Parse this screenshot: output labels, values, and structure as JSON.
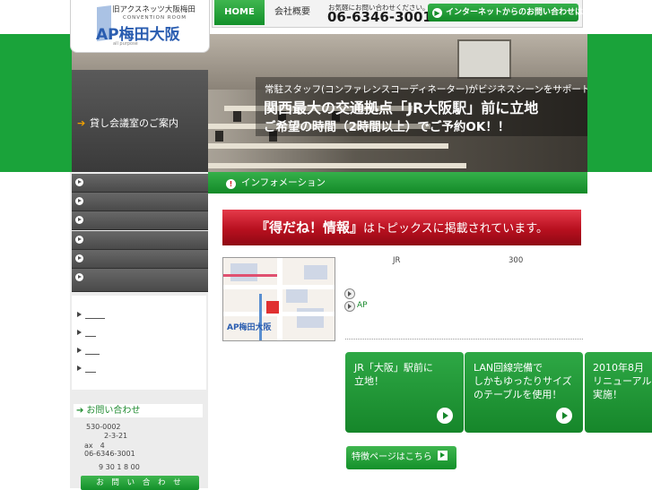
{
  "colors": {
    "brand_green": "#1aa33a",
    "accent_red": "#b8101f",
    "logo_blue": "#2a5db0"
  },
  "logo": {
    "top_text": "旧アクスネッツ大阪梅田",
    "subtitle": "CONVENTION ROOM",
    "main_text": "AP梅田大阪",
    "tagline": "all purpose"
  },
  "header": {
    "nav": [
      {
        "label": "HOME"
      },
      {
        "label": "会社概要"
      }
    ],
    "contact_note": "お気軽にお問い合わせください。",
    "phone": "06-6346-3001",
    "internet_button": "インターネットからのお問い合わせはこちら"
  },
  "hero": {
    "line1": "常駐スタッフ(コンファレンスコーディネーター)がビジネスシーンをサポート",
    "line2": "関西最大の交通拠点「JR大阪駅」前に立地",
    "line3": "ご希望の時間（2時間以上）でご予約OK！！"
  },
  "sidebar": {
    "rental_label": "貸し会議室のご案内",
    "menu_count_icons": "arrow-icon",
    "inquiry": {
      "title": "お問い合わせ",
      "postal": "530-0002",
      "address": "2-3-21",
      "fax": "ax　4",
      "tel": "06-6346-3001",
      "hours": "9 30 1 8 00",
      "button": "お 問 い 合 わ せ"
    }
  },
  "main": {
    "info_title": "インフォメーション",
    "banner": {
      "strong": "『得だね！情報』",
      "rest": "はトピックスに掲載されています。"
    },
    "map_label": "AP梅田大阪",
    "address_jr": "JR",
    "address_300": "300",
    "ap_link": "AP",
    "features": [
      {
        "text": "JR「大阪」駅前に\n立地！"
      },
      {
        "text": "LAN回線完備で\nしかもゆったりサイズ\nのテーブルを使用！"
      },
      {
        "text": "2010年8月\nリニューアル\n実施！"
      }
    ],
    "feature_page_button": "特徴ページはこちら"
  }
}
